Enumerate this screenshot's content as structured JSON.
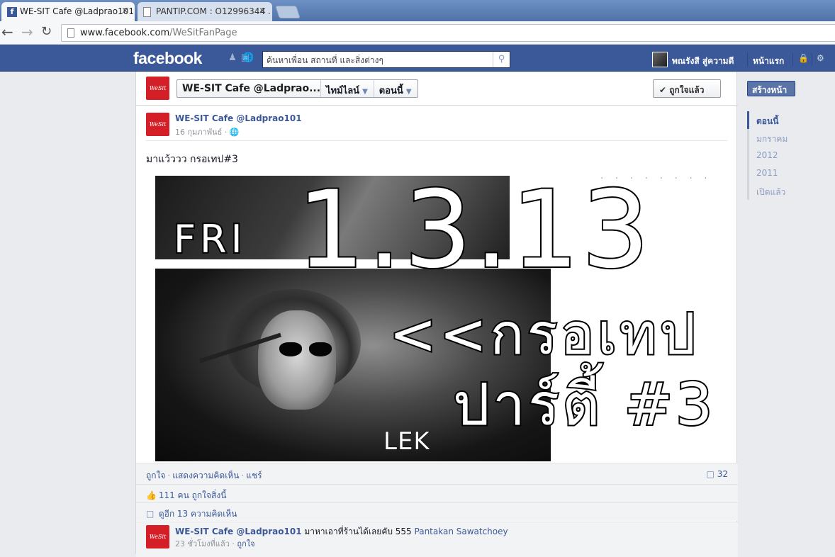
{
  "browser": {
    "tabs": [
      {
        "title": "WE-SIT Cafe @Ladprao101",
        "active": true,
        "close": "×"
      },
      {
        "title": "PANTIP.COM : O12996344 .",
        "active": false,
        "close": "×"
      }
    ],
    "url_host": "www.facebook.com",
    "url_path": "/WeSitFanPage"
  },
  "fb_header": {
    "logo": "facebook",
    "search_placeholder": "ค้นหาเพื่อน สถานที่ และสิ่งต่างๆ",
    "user_name": "พณรังสี สู่ความดี",
    "home_label": "หน้าแรก"
  },
  "page_header": {
    "page_name": "WE-SIT Cafe @Ladprao...",
    "timeline_label": "ไทม์ไลน์",
    "now_label": "ตอนนี้",
    "liked_label": "✔ ถูกใจแล้ว",
    "logo_text": "WeSit Cafe"
  },
  "post": {
    "author": "WE-SIT Cafe @Ladprao101",
    "date": "16 กุมภาพันธ์ ·",
    "text": "มาแว้ววว กรอเทป#3",
    "poster": {
      "day": "FRI",
      "date": "1.3.13",
      "line1": "<<กรอเทป",
      "line2": "ปาร์ตี้ #3",
      "artist": "LEK"
    },
    "actions": {
      "like": "ถูกใจ",
      "comment": "แสดงความคิดเห็น",
      "share": "แชร์",
      "comment_count": "32"
    },
    "likes_text": "111 คน ถูกใจสิ่งนี้",
    "view_more_text": "ดูอีก 13 ความคิดเห็น",
    "comment": {
      "author": "WE-SIT Cafe @Ladprao101",
      "text": " มาหาเอาที่ร้านได้เลยคับ 555 ",
      "tag": "Pantakan Sawatchoey",
      "time": "23 ชั่วโมงที่แล้ว · ",
      "like": "ถูกใจ"
    }
  },
  "right_rail": {
    "create_page": "สร้างหน้า",
    "timeline_items": [
      "ตอนนี้",
      "มกราคม",
      "2012",
      "2011",
      "เปิดแล้ว"
    ]
  },
  "colors": {
    "fb_blue": "#3b5998",
    "link": "#3b5998",
    "logo_red": "#d41f26"
  }
}
